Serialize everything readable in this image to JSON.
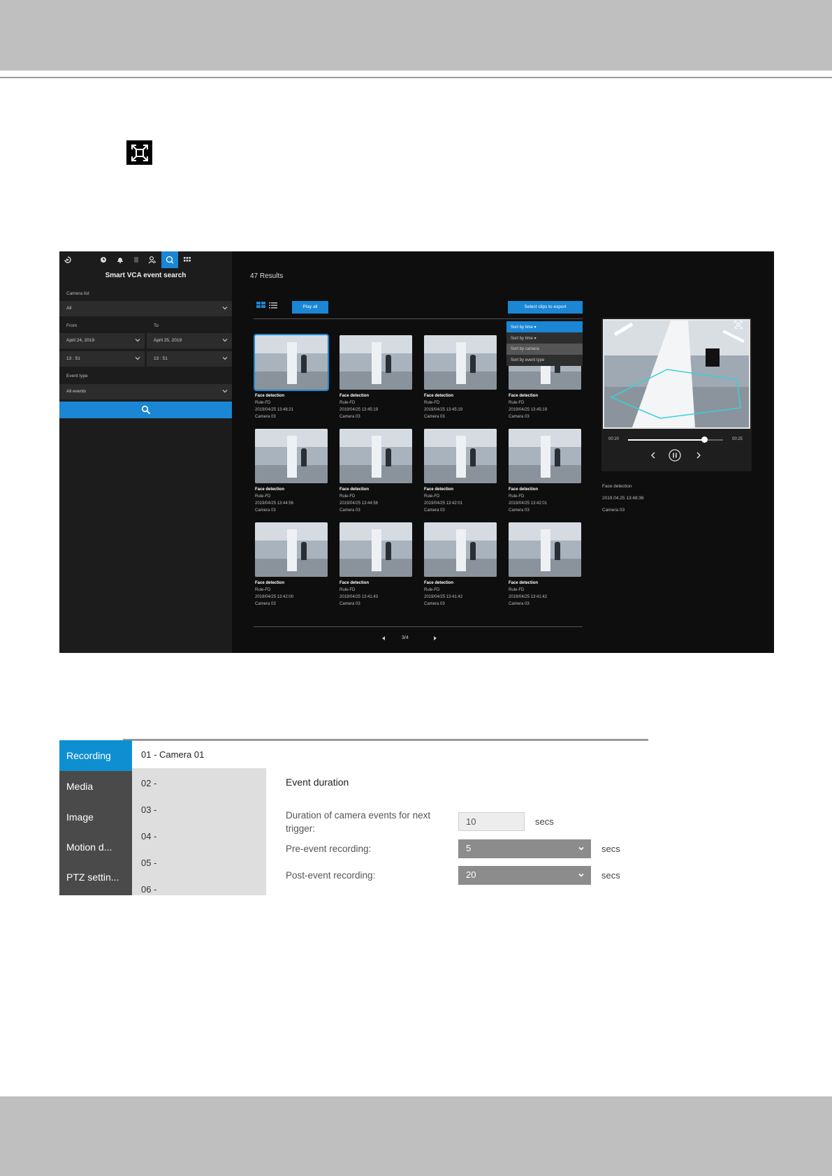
{
  "icons": {
    "fullscreen": "fullscreen-icon",
    "toolbar": [
      "playback-icon",
      "clock-icon",
      "bell-icon",
      "film-icon",
      "person-search-icon",
      "vca-search-icon",
      "grid-icon"
    ],
    "search": "search-icon",
    "chevron": "chevron-down-icon"
  },
  "vca": {
    "title": "Smart VCA event search",
    "camera_list_label": "Camera list",
    "camera_list_value": "All",
    "from_label": "From",
    "to_label": "To",
    "from_date": "April 24, 2019",
    "to_date": "April 25, 2019",
    "from_time": "13 : 51",
    "to_time": "13 : 51",
    "event_type_label": "Event type",
    "event_type_value": "All events",
    "results": "47 Results",
    "play_all": "Play all",
    "select_clips": "Select clips to export",
    "sort_options": [
      "Sort by time",
      "Sort by time",
      "Sort by camera",
      "Sort by event type"
    ],
    "thumbnails": [
      {
        "title": "Face detection",
        "rule": "Rule-FD",
        "time": "2019/04/25 13:48:21",
        "camera": "Camera 03"
      },
      {
        "title": "Face detection",
        "rule": "Rule-FD",
        "time": "2019/04/25 13:45:19",
        "camera": "Camera 03"
      },
      {
        "title": "Face detection",
        "rule": "Rule-FD",
        "time": "2019/04/25 13:45:19",
        "camera": "Camera 03"
      },
      {
        "title": "Face detection",
        "rule": "Rule-FD",
        "time": "2019/04/25 13:45:19",
        "camera": "Camera 03"
      },
      {
        "title": "Face detection",
        "rule": "Rule-FD",
        "time": "2019/04/25 13:44:56",
        "camera": "Camera 03"
      },
      {
        "title": "Face detection",
        "rule": "Rule-FD",
        "time": "2019/04/25 13:44:56",
        "camera": "Camera 03"
      },
      {
        "title": "Face detection",
        "rule": "Rule-FD",
        "time": "2019/04/25 13:42:01",
        "camera": "Camera 03"
      },
      {
        "title": "Face detection",
        "rule": "Rule-FD",
        "time": "2019/04/25 13:42:01",
        "camera": "Camera 03"
      },
      {
        "title": "Face detection",
        "rule": "Rule-FD",
        "time": "2019/04/25 13:42:00",
        "camera": "Camera 03"
      },
      {
        "title": "Face detection",
        "rule": "Rule-FD",
        "time": "2019/04/25 13:41:43",
        "camera": "Camera 03"
      },
      {
        "title": "Face detection",
        "rule": "Rule-FD",
        "time": "2019/04/25 13:41:42",
        "camera": "Camera 03"
      },
      {
        "title": "Face detection",
        "rule": "Rule-FD",
        "time": "2019/04/25 13:41:42",
        "camera": "Camera 03"
      }
    ],
    "pager": "3/4",
    "player": {
      "time_current": "00:20",
      "time_total": "00:25",
      "progress": 0.8
    },
    "detail": {
      "event": "Face detection",
      "time": "2019.04.25 13:48:36",
      "camera": "Camera 03"
    }
  },
  "settings": {
    "nav": [
      "Recording",
      "Media",
      "Image",
      "Motion d...",
      "PTZ settin..."
    ],
    "camera_selected": "01 - Camera 01",
    "cameras": [
      "02 -",
      "03 -",
      "04 -",
      "05 -",
      "06 -"
    ],
    "section_title": "Event duration",
    "duration_label": "Duration of camera events for next trigger:",
    "duration_value": "10",
    "pre_label": "Pre-event recording:",
    "pre_value": "5",
    "post_label": "Post-event recording:",
    "post_value": "20",
    "unit": "secs"
  },
  "colors": {
    "accent": "#1a86d4",
    "nav_active": "#0e8fd1",
    "band": "#bfbfbf"
  }
}
